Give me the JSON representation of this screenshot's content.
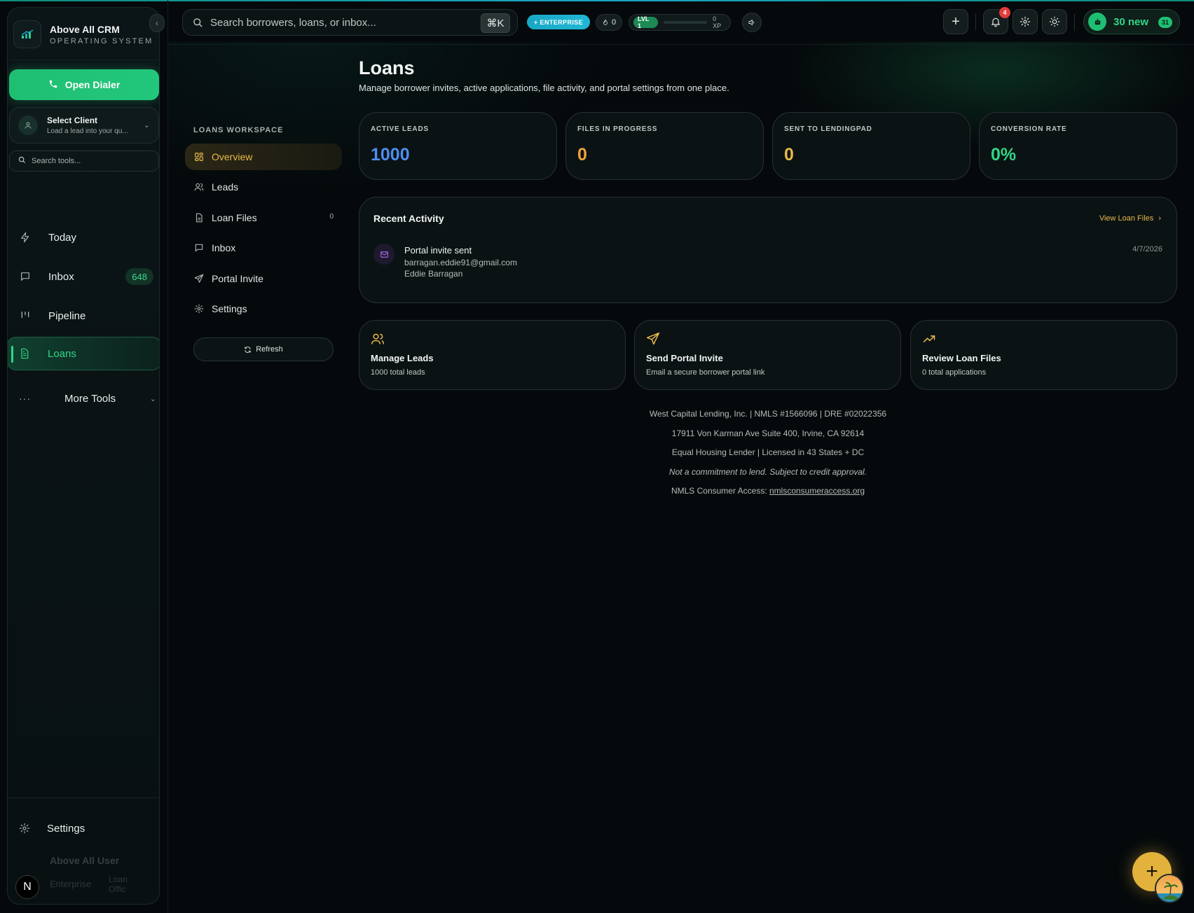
{
  "brand": {
    "title": "Above All CRM",
    "subtitle": "OPERATING SYSTEM"
  },
  "sidebar": {
    "dialer_label": "Open Dialer",
    "client": {
      "title": "Select Client",
      "subtitle": "Load a lead into your qu..."
    },
    "tools_search_placeholder": "Search tools...",
    "items": [
      {
        "label": "Today",
        "icon": "bolt-icon"
      },
      {
        "label": "Inbox",
        "icon": "message-icon",
        "badge": "648"
      },
      {
        "label": "Pipeline",
        "icon": "pipeline-icon"
      },
      {
        "label": "Loans",
        "icon": "document-icon",
        "active": true
      }
    ],
    "more_tools_label": "More Tools",
    "settings_label": "Settings",
    "user": {
      "name": "Above All User",
      "plan": "Enterprise",
      "meta_line1": "Loan",
      "meta_line2": "Offic"
    },
    "n_badge": "N"
  },
  "topbar": {
    "search_placeholder": "Search borrowers, loans, or inbox...",
    "shortcut": "⌘K",
    "plan_badge": "+ ENTERPRISE",
    "streak": "0",
    "level": "LVL 1",
    "xp": "0 XP",
    "xp_progress": 0.0,
    "notifications_count": "4",
    "new_label": "30 new",
    "new_count": "31"
  },
  "workspace": {
    "title": "LOANS WORKSPACE",
    "items": [
      {
        "label": "Overview",
        "active": true
      },
      {
        "label": "Leads"
      },
      {
        "label": "Loan Files",
        "count": "0"
      },
      {
        "label": "Inbox"
      },
      {
        "label": "Portal Invite"
      },
      {
        "label": "Settings"
      }
    ],
    "refresh_label": "Refresh"
  },
  "main": {
    "title": "Loans",
    "subtitle": "Manage borrower invites, active applications, file activity, and portal settings from one place.",
    "stats": [
      {
        "label": "ACTIVE LEADS",
        "value": "1000",
        "color": "#4d8ef0"
      },
      {
        "label": "FILES IN PROGRESS",
        "value": "0",
        "color": "#f0a23a"
      },
      {
        "label": "SENT TO LENDINGPAD",
        "value": "0",
        "color": "#e7b94a"
      },
      {
        "label": "CONVERSION RATE",
        "value": "0%",
        "color": "#2fd686"
      }
    ],
    "activity": {
      "title": "Recent Activity",
      "link": "View Loan Files",
      "event": "Portal invite sent",
      "email": "barragan.eddie91@gmail.com",
      "name": "Eddie Barragan",
      "date": "4/7/2026"
    },
    "actions": [
      {
        "title": "Manage Leads",
        "sub": "1000 total leads",
        "icon": "users-icon"
      },
      {
        "title": "Send Portal Invite",
        "sub": "Email a secure borrower portal link",
        "icon": "send-icon"
      },
      {
        "title": "Review Loan Files",
        "sub": "0 total applications",
        "icon": "trending-up-icon"
      }
    ],
    "footer": {
      "line1": "West Capital Lending, Inc. | NMLS #1566096 | DRE #02022356",
      "line2": "17911 Von Karman Ave Suite 400, Irvine, CA 92614",
      "line3": "Equal Housing Lender | Licensed in 43 States + DC",
      "line4": "Not a commitment to lend. Subject to credit approval.",
      "line5_prefix": "NMLS Consumer Access: ",
      "line5_link": "nmlsconsumeraccess.org"
    }
  },
  "colors": {
    "accent_green": "#2fd686",
    "accent_gold": "#e7b94a",
    "enterprise": "#1aa7c6",
    "danger": "#e53b3b"
  }
}
